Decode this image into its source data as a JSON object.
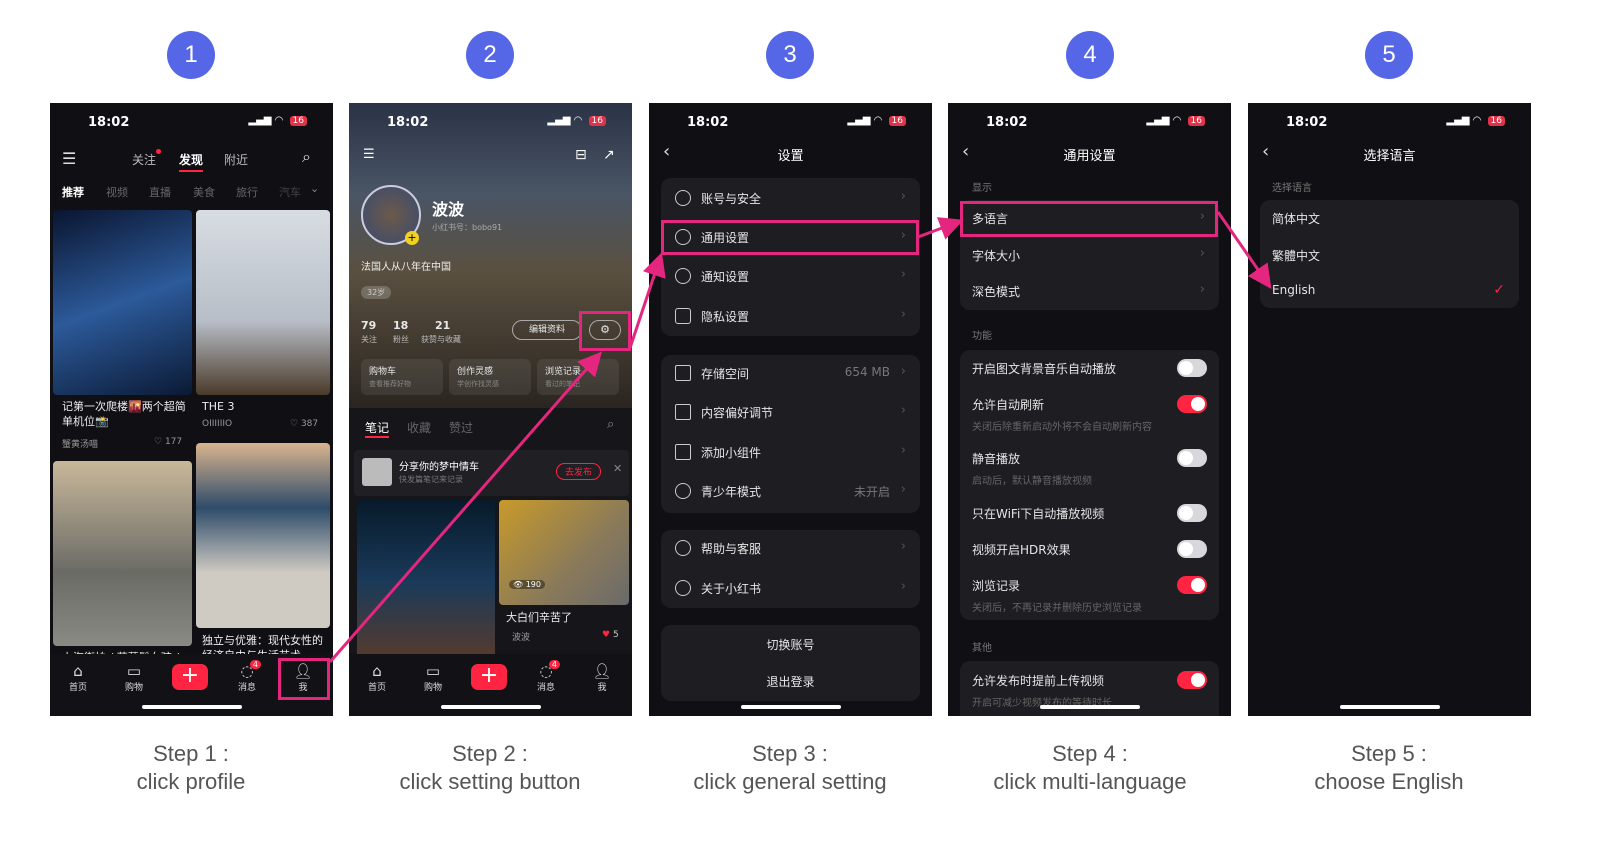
{
  "steps": [
    {
      "number": "1",
      "title": "Step 1 :",
      "desc": "click profile"
    },
    {
      "number": "2",
      "title": "Step 2 :",
      "desc": "click setting button"
    },
    {
      "number": "3",
      "title": "Step 3 :",
      "desc": "click general setting"
    },
    {
      "number": "4",
      "title": "Step 4 :",
      "desc": "click multi-language"
    },
    {
      "number": "5",
      "title": "Step 5 :",
      "desc": "choose English"
    }
  ],
  "status": {
    "time": "18:02",
    "battery": "16"
  },
  "colors": {
    "accent": "#ff2442",
    "highlight": "#e5267e",
    "step_circle": "#5566e6"
  },
  "tabbar": {
    "home": "首页",
    "shop": "购物",
    "plus": "+",
    "messages": "消息",
    "messages_badge": "4",
    "me": "我"
  },
  "screen1": {
    "top_tabs": [
      "关注",
      "发现",
      "附近"
    ],
    "categories": [
      "推荐",
      "视频",
      "直播",
      "美食",
      "旅行",
      "汽车"
    ],
    "cards": [
      {
        "title": "记第一次爬楼🌇两个超简单机位📸",
        "author": "蟹黄汤喵",
        "likes": "177"
      },
      {
        "title": "THE 3",
        "author": "OIIIIIIO",
        "likes": "387"
      },
      {
        "title": "上海街拍 / 茵蔓髦女孩 / 图"
      },
      {
        "title": "独立与优雅：现代女性的经济自由与生活艺术"
      }
    ]
  },
  "screen2": {
    "name": "波波",
    "id": "小红书号：bobo91",
    "bio": "法国人从八年在中国",
    "age": "32岁",
    "stats": [
      {
        "value": "79",
        "label": "关注"
      },
      {
        "value": "18",
        "label": "粉丝"
      },
      {
        "value": "21",
        "label": "获赞与收藏"
      }
    ],
    "edit_button": "编辑资料",
    "shortcuts": [
      {
        "title": "购物车",
        "sub": "查看推荐好物"
      },
      {
        "title": "创作灵感",
        "sub": "学创作找灵感"
      },
      {
        "title": "浏览记录",
        "sub": "看过的笔记"
      }
    ],
    "tabs": [
      "笔记",
      "收藏",
      "赞过"
    ],
    "banner": {
      "title": "分享你的梦中情车",
      "sub": "快发篇笔记来记录",
      "button": "去发布"
    },
    "post": {
      "views": "190",
      "title": "大白们辛苦了",
      "author": "波波",
      "likes": "5"
    }
  },
  "screen3": {
    "title": "设置",
    "group1": [
      "账号与安全",
      "通用设置",
      "通知设置",
      "隐私设置"
    ],
    "group2": [
      {
        "label": "存储空间",
        "value": "654 MB"
      },
      {
        "label": "内容偏好调节",
        "value": ""
      },
      {
        "label": "添加小组件",
        "value": ""
      },
      {
        "label": "青少年模式",
        "value": "未开启"
      }
    ],
    "group3": [
      "帮助与客服",
      "关于小红书"
    ],
    "switch_account": "切换账号",
    "logout": "退出登录"
  },
  "screen4": {
    "title": "通用设置",
    "section_display": "显示",
    "display": [
      "多语言",
      "字体大小",
      "深色模式"
    ],
    "section_features": "功能",
    "toggles": [
      {
        "label": "开启图文背景音乐自动播放",
        "sub": "",
        "on": false
      },
      {
        "label": "允许自动刷新",
        "sub": "关闭后除重新启动外将不会自动刷新内容",
        "on": true
      },
      {
        "label": "静音播放",
        "sub": "启动后，默认静音播放视频",
        "on": false
      },
      {
        "label": "只在WiFi下自动播放视频",
        "sub": "",
        "on": false
      },
      {
        "label": "视频开启HDR效果",
        "sub": "",
        "on": false
      },
      {
        "label": "浏览记录",
        "sub": "关闭后，不再记录并删除历史浏览记录",
        "on": true
      }
    ],
    "section_other": "其他",
    "other": {
      "label": "允许发布时提前上传视频",
      "sub": "开启可减少视频发布的等待时长",
      "on": true
    }
  },
  "screen5": {
    "title": "选择语言",
    "section": "选择语言",
    "languages": [
      "简体中文",
      "繁體中文",
      "English"
    ],
    "selected": "English"
  }
}
